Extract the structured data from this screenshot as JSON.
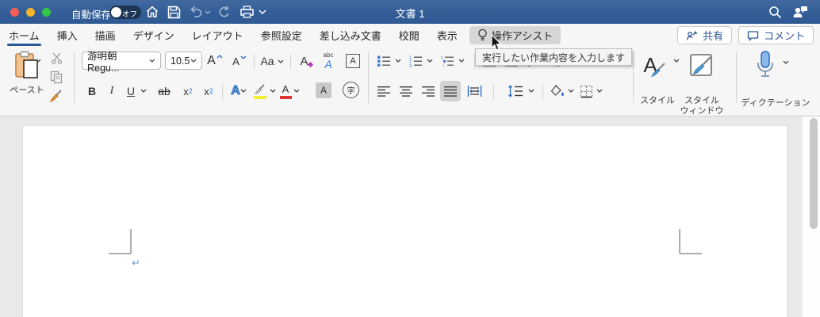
{
  "window": {
    "autosave_label": "自動保存",
    "autosave_state": "オフ",
    "title": "文書 1"
  },
  "tabs": [
    {
      "label": "ホーム",
      "active": true
    },
    {
      "label": "挿入"
    },
    {
      "label": "描画"
    },
    {
      "label": "デザイン"
    },
    {
      "label": "レイアウト"
    },
    {
      "label": "参照設定"
    },
    {
      "label": "差し込み文書"
    },
    {
      "label": "校閲"
    },
    {
      "label": "表示"
    },
    {
      "label": "操作アシスト",
      "highlighted": true
    }
  ],
  "header_buttons": {
    "share": "共有",
    "comments": "コメント"
  },
  "tooltip": {
    "text": "実行したい作業内容を入力します"
  },
  "ribbon": {
    "paste_label": "ペースト",
    "font_name": "游明朝 Regu...",
    "font_size": "10.5",
    "glyphs": {
      "grow": "A",
      "shrink": "A",
      "change_case": "Aa",
      "clear_format": "A",
      "ruby_top": "abc",
      "ruby_a": "A",
      "boxed_a": "A",
      "bold": "B",
      "italic": "I",
      "underline": "U",
      "strike": "ab",
      "sub_x": "x",
      "sub_n": "2",
      "sup_x": "x",
      "sup_n": "2",
      "effects": "A",
      "font_color": "A",
      "shading": "A",
      "enclose": "字",
      "styles_a": "A"
    },
    "styles_label": "スタイル",
    "styles_window_line1": "スタイル",
    "styles_window_line2": "ウィンドウ",
    "dictation_label": "ディクテーション"
  },
  "document": {
    "paragraph_mark": "↵"
  },
  "colors": {
    "accent": "#2b579a",
    "titlebar": "#35619b",
    "assist_tab_bg": "#d6d6d6",
    "selected_gray": "#d2d2d2",
    "highlight_yellow": "#f3ee33",
    "font_color_red": "#e03535",
    "mic_blue": "#8ab8ea",
    "paragraph_mark_blue": "#64a1e0"
  }
}
